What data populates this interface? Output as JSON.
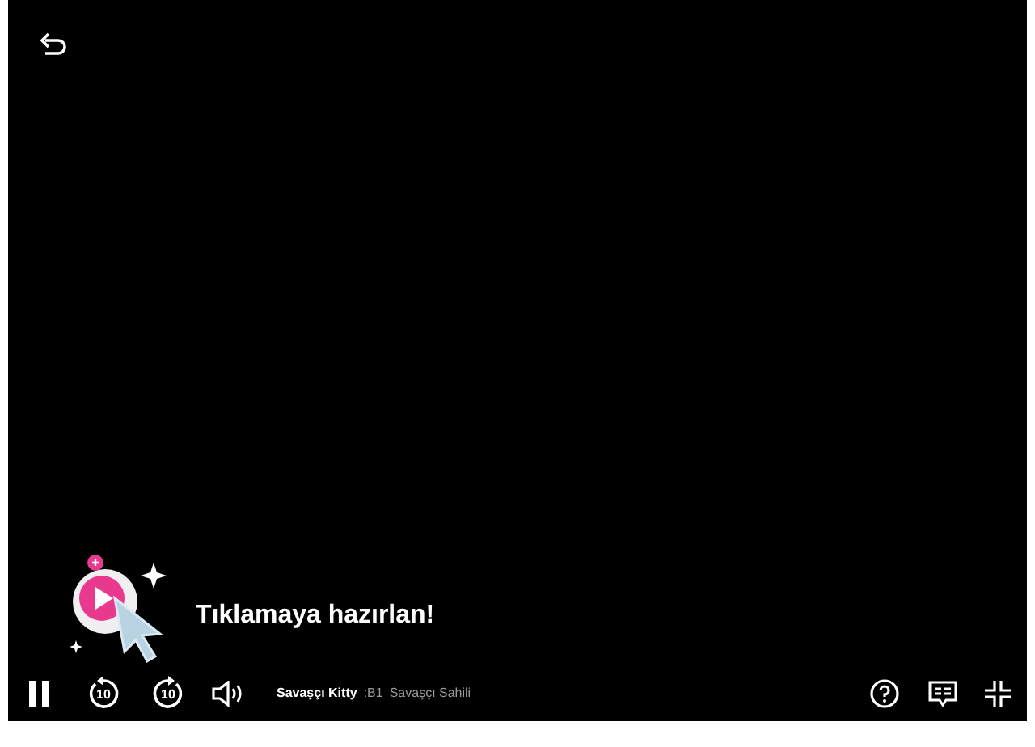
{
  "player": {
    "playing": true,
    "prompt": "Tıklamaya hazırlan!",
    "title": "Savaşçı Kitty",
    "episode": ":B1",
    "episode_title": "Savaşçı Sahili",
    "skip_back": "10",
    "skip_forward": "10"
  }
}
